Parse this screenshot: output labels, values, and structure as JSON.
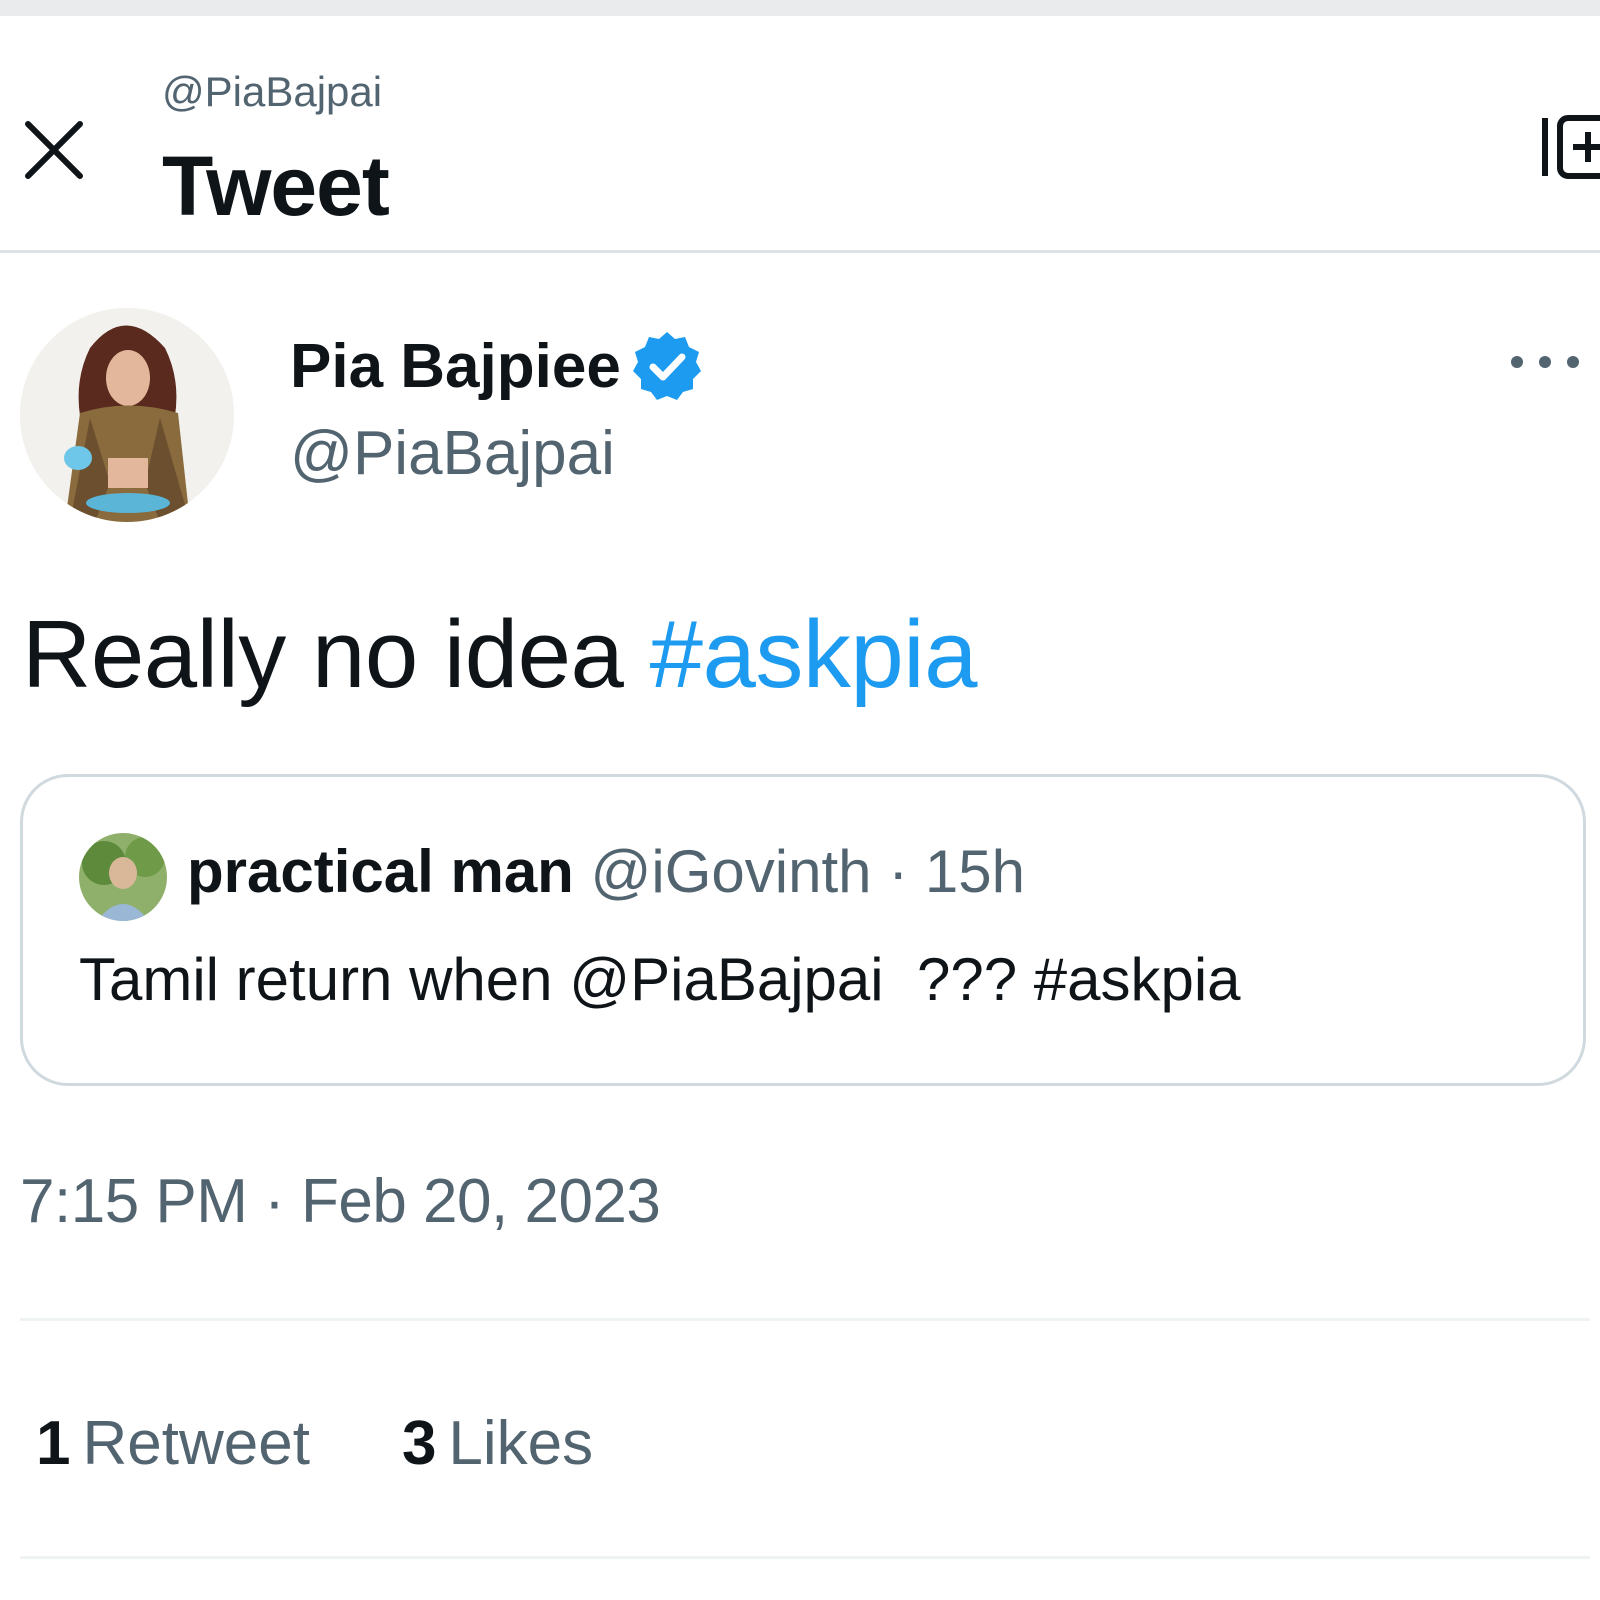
{
  "header": {
    "handle": "@PiaBajpai",
    "title": "Tweet",
    "close_icon": "close-icon",
    "reader_icon": "reader-mode-icon"
  },
  "tweet": {
    "author_name": "Pia Bajpiee",
    "author_handle": "@PiaBajpai",
    "verified": true,
    "more_icon": "more-icon",
    "text": "Really no idea",
    "hashtag": "#askpia",
    "timestamp": "7:15 PM · Feb 20, 2023"
  },
  "quoted_tweet": {
    "author_name": "practical man",
    "author_handle": "@iGovinth",
    "separator": "·",
    "age": "15h",
    "text": "Tamil return when @PiaBajpai  ??? #askpia"
  },
  "stats": [
    {
      "count": "1",
      "label": "Retweet"
    },
    {
      "count": "3",
      "label": "Likes"
    }
  ],
  "colors": {
    "accent": "#1d9bf0",
    "text_primary": "#0f1419",
    "text_secondary": "#536471",
    "border": "#cfd9de"
  }
}
